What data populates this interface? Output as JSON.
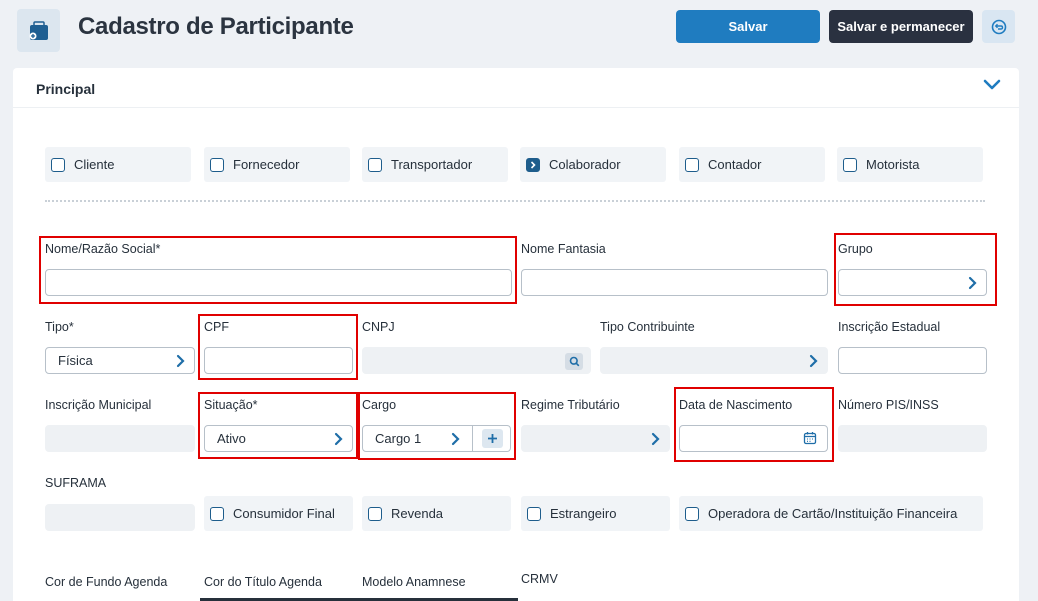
{
  "header": {
    "title": "Cadastro de Participante",
    "save_label": "Salvar",
    "save_stay_label": "Salvar e permanecer"
  },
  "section": {
    "title": "Principal"
  },
  "types": [
    {
      "label": "Cliente",
      "checked": false
    },
    {
      "label": "Fornecedor",
      "checked": false
    },
    {
      "label": "Transportador",
      "checked": false
    },
    {
      "label": "Colaborador",
      "checked": true
    },
    {
      "label": "Contador",
      "checked": false
    },
    {
      "label": "Motorista",
      "checked": false
    }
  ],
  "fields": {
    "nome": {
      "label": "Nome/Razão Social*",
      "value": ""
    },
    "nome_fantasia": {
      "label": "Nome Fantasia",
      "value": ""
    },
    "grupo": {
      "label": "Grupo",
      "value": ""
    },
    "tipo": {
      "label": "Tipo*",
      "value": "Física"
    },
    "cpf": {
      "label": "CPF",
      "value": ""
    },
    "cnpj": {
      "label": "CNPJ",
      "value": ""
    },
    "tipo_contribuinte": {
      "label": "Tipo Contribuinte",
      "value": ""
    },
    "inscricao_estadual": {
      "label": "Inscrição Estadual",
      "value": ""
    },
    "inscricao_municipal": {
      "label": "Inscrição Municipal",
      "value": ""
    },
    "situacao": {
      "label": "Situação*",
      "value": "Ativo"
    },
    "cargo": {
      "label": "Cargo",
      "value": "Cargo 1"
    },
    "regime_tributario": {
      "label": "Regime Tributário",
      "value": ""
    },
    "data_nascimento": {
      "label": "Data de Nascimento",
      "value": ""
    },
    "numero_pis": {
      "label": "Número PIS/INSS",
      "value": ""
    },
    "suframa": {
      "label": "SUFRAMA",
      "value": ""
    }
  },
  "flags": [
    {
      "label": "Consumidor Final",
      "checked": false
    },
    {
      "label": "Revenda",
      "checked": false
    },
    {
      "label": "Estrangeiro",
      "checked": false
    },
    {
      "label": "Operadora de Cartão/Instituição Financeira",
      "checked": false
    }
  ],
  "bottom_labels": {
    "cor_fundo": "Cor de Fundo Agenda",
    "cor_titulo": "Cor do Título Agenda",
    "modelo_anamnese": "Modelo Anamnese",
    "crmv": "CRMV"
  },
  "colors": {
    "primary": "#1f7cc0",
    "dark": "#2a3140",
    "highlight": "#e00000"
  },
  "icons": {
    "app": "folder-icon",
    "back": "undo-icon",
    "collapse": "chevron-down-icon",
    "select": "chevron-right-icon",
    "search": "search-icon",
    "add": "plus-icon",
    "calendar": "calendar-icon"
  }
}
